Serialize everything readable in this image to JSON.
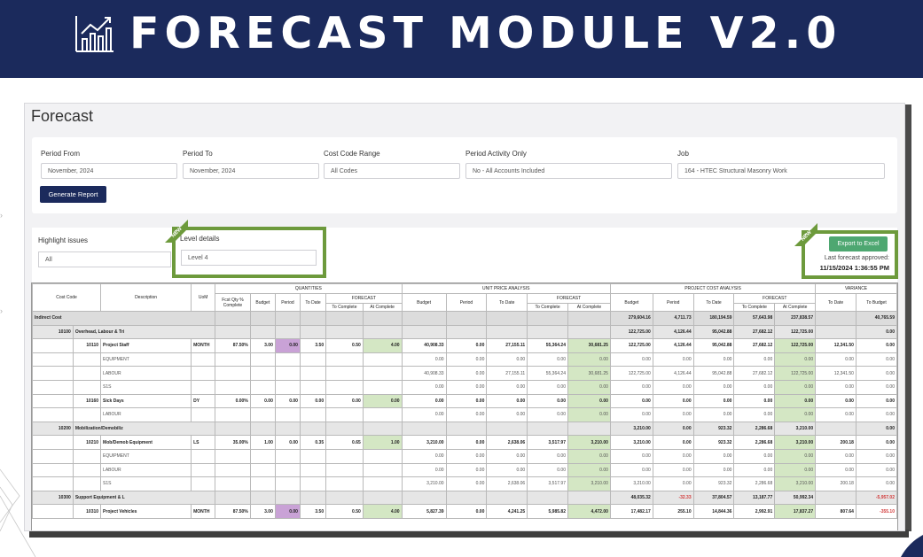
{
  "banner": {
    "title": "FORECAST MODULE V2.0",
    "icon": "chart-icon"
  },
  "page": {
    "title": "Forecast"
  },
  "filters": {
    "period_from": {
      "label": "Period From",
      "value": "November, 2024"
    },
    "period_to": {
      "label": "Period To",
      "value": "November, 2024"
    },
    "cost_code_range": {
      "label": "Cost Code Range",
      "value": "All Codes"
    },
    "period_activity": {
      "label": "Period Activity Only",
      "value": "No - All Accounts Included"
    },
    "job": {
      "label": "Job",
      "value": "164 - HTEC Structural Masonry Work"
    },
    "generate_label": "Generate Report"
  },
  "highlight": {
    "label": "Highlight issues",
    "value": "All"
  },
  "level": {
    "label": "Level details",
    "value": "Level 4"
  },
  "new_tag": "NEW",
  "export": {
    "label": "Export to Excel",
    "approved_label": "Last forecast approved:",
    "approved_value": "11/15/2024 1:36:55 PM"
  },
  "colors": {
    "navy": "#1b2a5c",
    "green_frame": "#6d9a3c",
    "excel_green": "#4ea771",
    "purple": "#c9a2d6",
    "light_green": "#d4e7c4"
  },
  "grid": {
    "groups": [
      "QUANTITIES",
      "UNIT PRICE ANALYSIS",
      "PROJECT COST ANALYSIS",
      "VARIANCE"
    ],
    "forecast_label": "FORECAST",
    "head": {
      "cost_code": "Cost Code",
      "description": "Description",
      "uom": "UoM",
      "fcst_qty": "Fcst Qty % Complete",
      "budget": "Budget",
      "period": "Period",
      "to_date": "To Date",
      "to_complete": "To Complete",
      "at_complete": "At Complete",
      "to_budget": "To Budget"
    },
    "rows": [
      {
        "type": "group",
        "code": "Indirect Cost",
        "desc": "",
        "uom": "",
        "q": [
          "",
          "",
          "",
          "",
          "",
          ""
        ],
        "u": [
          "",
          "",
          "",
          "",
          ""
        ],
        "p": [
          "279,604.16",
          "4,711.73",
          "180,194.59",
          "57,643.98",
          "237,838.57"
        ],
        "v": [
          "",
          "40,765.59"
        ]
      },
      {
        "type": "sub",
        "code": "10100",
        "desc": "Overhead, Labour & Tri",
        "uom": "",
        "q": [
          "",
          "",
          "",
          "",
          "",
          ""
        ],
        "u": [
          "",
          "",
          "",
          "",
          ""
        ],
        "p": [
          "122,725.00",
          "4,126.44",
          "95,042.88",
          "27,682.12",
          "122,725.00"
        ],
        "v": [
          "",
          "0.00"
        ]
      },
      {
        "type": "item",
        "code": "10110",
        "desc": "Project Staff",
        "uom": "MONTH",
        "q": [
          "87.50%",
          "3.00",
          "0.00",
          "3.50",
          "0.50",
          "4.00"
        ],
        "u": [
          "40,908.33",
          "0.00",
          "27,155.11",
          "55,364.24",
          "30,681.25"
        ],
        "p": [
          "122,725.00",
          "4,126.44",
          "95,042.88",
          "27,682.12",
          "122,725.00"
        ],
        "v": [
          "12,341.50",
          "0.00"
        ]
      },
      {
        "type": "res",
        "code": "",
        "desc": "EQUIPMENT",
        "uom": "",
        "q": [
          "",
          "",
          "",
          "",
          "",
          ""
        ],
        "u": [
          "0.00",
          "0.00",
          "0.00",
          "0.00",
          "0.00"
        ],
        "p": [
          "0.00",
          "0.00",
          "0.00",
          "0.00",
          "0.00"
        ],
        "v": [
          "0.00",
          "0.00"
        ]
      },
      {
        "type": "res",
        "code": "",
        "desc": "LABOUR",
        "uom": "",
        "q": [
          "",
          "",
          "",
          "",
          "",
          ""
        ],
        "u": [
          "40,908.33",
          "0.00",
          "27,155.11",
          "55,364.24",
          "30,681.25"
        ],
        "p": [
          "122,725.00",
          "4,126.44",
          "95,042.88",
          "27,682.12",
          "122,725.00"
        ],
        "v": [
          "12,341.50",
          "0.00"
        ]
      },
      {
        "type": "res",
        "code": "",
        "desc": "S1S",
        "uom": "",
        "q": [
          "",
          "",
          "",
          "",
          "",
          ""
        ],
        "u": [
          "0.00",
          "0.00",
          "0.00",
          "0.00",
          "0.00"
        ],
        "p": [
          "0.00",
          "0.00",
          "0.00",
          "0.00",
          "0.00"
        ],
        "v": [
          "0.00",
          "0.00"
        ]
      },
      {
        "type": "item",
        "code": "10160",
        "desc": "Sick Days",
        "uom": "DY",
        "q": [
          "0.00%",
          "0.00",
          "0.00",
          "0.00",
          "0.00",
          "0.00"
        ],
        "u": [
          "0.00",
          "0.00",
          "0.00",
          "0.00",
          "0.00"
        ],
        "p": [
          "0.00",
          "0.00",
          "0.00",
          "0.00",
          "0.00"
        ],
        "v": [
          "0.00",
          "0.00"
        ]
      },
      {
        "type": "res",
        "code": "",
        "desc": "LABOUR",
        "uom": "",
        "q": [
          "",
          "",
          "",
          "",
          "",
          ""
        ],
        "u": [
          "0.00",
          "0.00",
          "0.00",
          "0.00",
          "0.00"
        ],
        "p": [
          "0.00",
          "0.00",
          "0.00",
          "0.00",
          "0.00"
        ],
        "v": [
          "0.00",
          "0.00"
        ]
      },
      {
        "type": "sub",
        "code": "10200",
        "desc": "Mobilization/Demobiliz",
        "uom": "",
        "q": [
          "",
          "",
          "",
          "",
          "",
          ""
        ],
        "u": [
          "",
          "",
          "",
          "",
          ""
        ],
        "p": [
          "3,210.00",
          "0.00",
          "923.32",
          "2,286.68",
          "3,210.00"
        ],
        "v": [
          "",
          "0.00"
        ]
      },
      {
        "type": "item",
        "code": "10210",
        "desc": "Mob/Demob Equipment",
        "uom": "LS",
        "q": [
          "35.00%",
          "1.00",
          "0.00",
          "0.35",
          "0.65",
          "1.00"
        ],
        "u": [
          "3,210.00",
          "0.00",
          "2,638.06",
          "3,517.97",
          "3,210.00"
        ],
        "p": [
          "3,210.00",
          "0.00",
          "923.32",
          "2,286.68",
          "3,210.00"
        ],
        "v": [
          "200.18",
          "0.00"
        ]
      },
      {
        "type": "res",
        "code": "",
        "desc": "EQUIPMENT",
        "uom": "",
        "q": [
          "",
          "",
          "",
          "",
          "",
          ""
        ],
        "u": [
          "0.00",
          "0.00",
          "0.00",
          "0.00",
          "0.00"
        ],
        "p": [
          "0.00",
          "0.00",
          "0.00",
          "0.00",
          "0.00"
        ],
        "v": [
          "0.00",
          "0.00"
        ]
      },
      {
        "type": "res",
        "code": "",
        "desc": "LABOUR",
        "uom": "",
        "q": [
          "",
          "",
          "",
          "",
          "",
          ""
        ],
        "u": [
          "0.00",
          "0.00",
          "0.00",
          "0.00",
          "0.00"
        ],
        "p": [
          "0.00",
          "0.00",
          "0.00",
          "0.00",
          "0.00"
        ],
        "v": [
          "0.00",
          "0.00"
        ]
      },
      {
        "type": "res",
        "code": "",
        "desc": "S1S",
        "uom": "",
        "q": [
          "",
          "",
          "",
          "",
          "",
          ""
        ],
        "u": [
          "3,210.00",
          "0.00",
          "2,638.06",
          "3,517.97",
          "3,210.00"
        ],
        "p": [
          "3,210.00",
          "0.00",
          "923.32",
          "2,286.68",
          "3,210.00"
        ],
        "v": [
          "200.18",
          "0.00"
        ]
      },
      {
        "type": "sub",
        "code": "10300",
        "desc": "Support Equipment & L",
        "uom": "",
        "q": [
          "",
          "",
          "",
          "",
          "",
          ""
        ],
        "u": [
          "",
          "",
          "",
          "",
          ""
        ],
        "p": [
          "48,035.32",
          "-32.33",
          "37,804.57",
          "13,187.77",
          "50,992.34"
        ],
        "v": [
          "",
          "-5,957.02"
        ]
      },
      {
        "type": "item",
        "code": "10310",
        "desc": "Project Vehicles",
        "uom": "MONTH",
        "q": [
          "87.50%",
          "3.00",
          "0.00",
          "3.50",
          "0.50",
          "4.00"
        ],
        "u": [
          "5,827.39",
          "0.00",
          "4,241.25",
          "5,985.82",
          "4,472.00"
        ],
        "p": [
          "17,482.17",
          "255.10",
          "14,844.36",
          "2,992.91",
          "17,837.27"
        ],
        "v": [
          "807.64",
          "-355.10"
        ]
      }
    ]
  }
}
